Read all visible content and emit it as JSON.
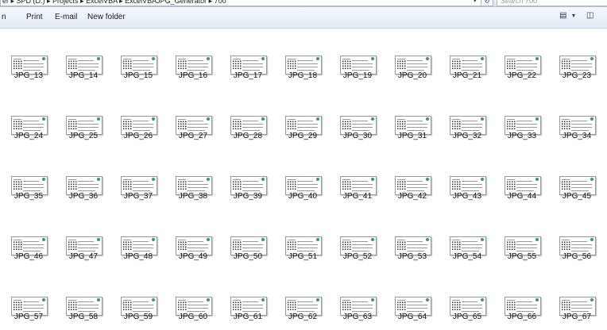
{
  "address_bar": {
    "path": "er ▸ SPD (D:) ▸ Projects ▸ ExcelVBA ▸ ExcelVBAJPG_Generator ▸ 700",
    "search_placeholder": "Search 700"
  },
  "toolbar": {
    "first_label": "n",
    "print_label": "Print",
    "email_label": "E-mail",
    "new_folder_label": "New folder"
  },
  "files": [
    "JPG_13",
    "JPG_14",
    "JPG_15",
    "JPG_16",
    "JPG_17",
    "JPG_18",
    "JPG_19",
    "JPG_20",
    "JPG_21",
    "JPG_22",
    "JPG_23",
    "JPG_24",
    "JPG_25",
    "JPG_26",
    "JPG_27",
    "JPG_28",
    "JPG_29",
    "JPG_30",
    "JPG_31",
    "JPG_32",
    "JPG_33",
    "JPG_34",
    "JPG_35",
    "JPG_36",
    "JPG_37",
    "JPG_38",
    "JPG_39",
    "JPG_40",
    "JPG_41",
    "JPG_42",
    "JPG_43",
    "JPG_44",
    "JPG_45",
    "JPG_46",
    "JPG_47",
    "JPG_48",
    "JPG_49",
    "JPG_50",
    "JPG_51",
    "JPG_52",
    "JPG_53",
    "JPG_54",
    "JPG_55",
    "JPG_56",
    "JPG_57",
    "JPG_58",
    "JPG_59",
    "JPG_60",
    "JPG_61",
    "JPG_62",
    "JPG_63",
    "JPG_64",
    "JPG_65",
    "JPG_66",
    "JPG_67"
  ]
}
